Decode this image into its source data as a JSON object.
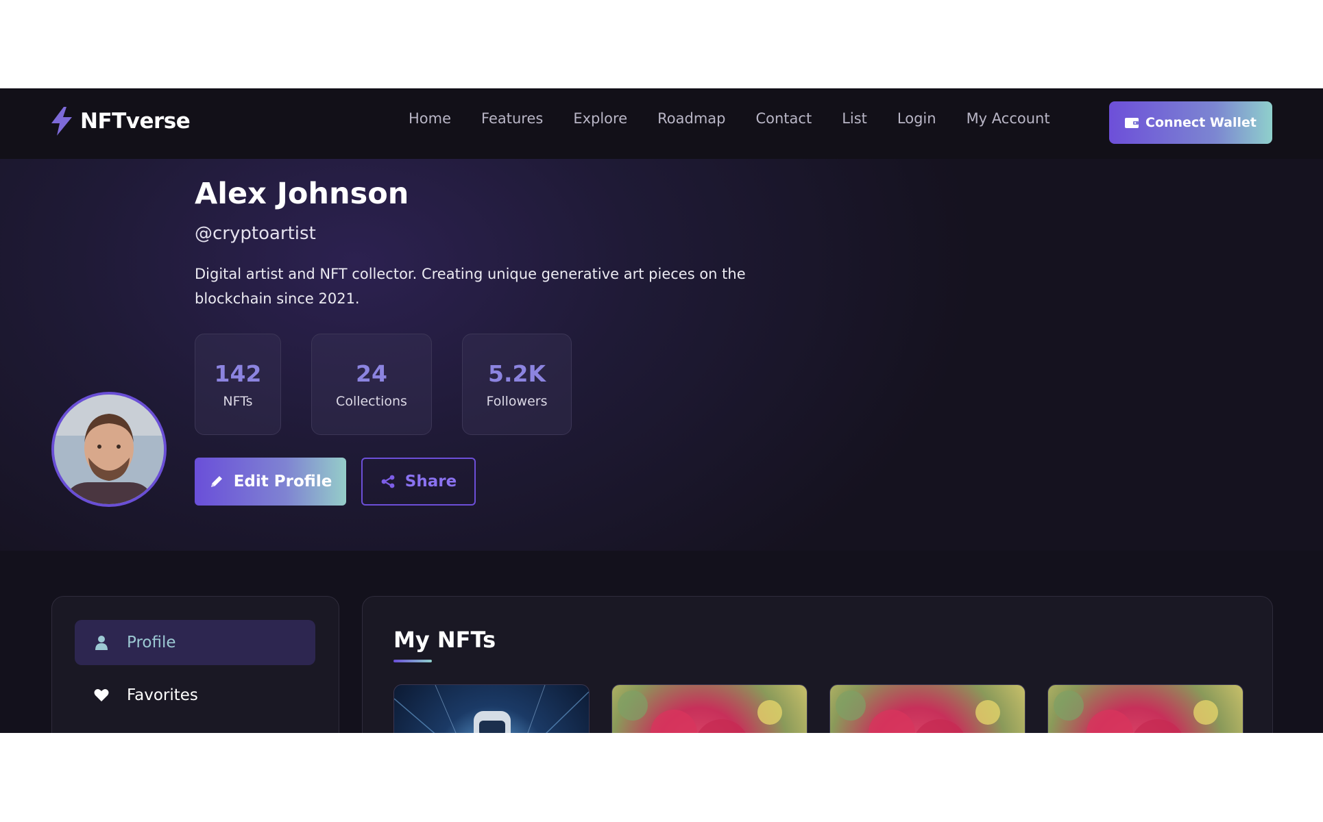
{
  "navbar": {
    "brand": "NFTverse",
    "links": [
      "Home",
      "Features",
      "Explore",
      "Roadmap",
      "Contact",
      "List",
      "Login",
      "My Account"
    ],
    "connect_label": "Connect Wallet"
  },
  "profile": {
    "name": "Alex Johnson",
    "handle": "@cryptoartist",
    "bio": "Digital artist and NFT collector. Creating unique generative art pieces on the blockchain since 2021.",
    "stats": [
      {
        "value": "142",
        "label": "NFTs"
      },
      {
        "value": "24",
        "label": "Collections"
      },
      {
        "value": "5.2K",
        "label": "Followers"
      }
    ],
    "edit_label": "Edit Profile",
    "share_label": "Share"
  },
  "sidebar": {
    "items": [
      {
        "label": "Profile",
        "icon": "user-icon",
        "active": true
      },
      {
        "label": "Favorites",
        "icon": "heart-icon",
        "active": false
      }
    ]
  },
  "main": {
    "title": "My NFTs",
    "cards": [
      {
        "image": "tech-robot-image"
      },
      {
        "image": "pink-flowers-image"
      },
      {
        "image": "pink-flowers-image"
      },
      {
        "image": "pink-flowers-image"
      }
    ]
  },
  "colors": {
    "accent": "#6d4fd9",
    "accent_end": "#8fd0cc",
    "background": "#13111c",
    "stat_value": "#8c84e0"
  }
}
